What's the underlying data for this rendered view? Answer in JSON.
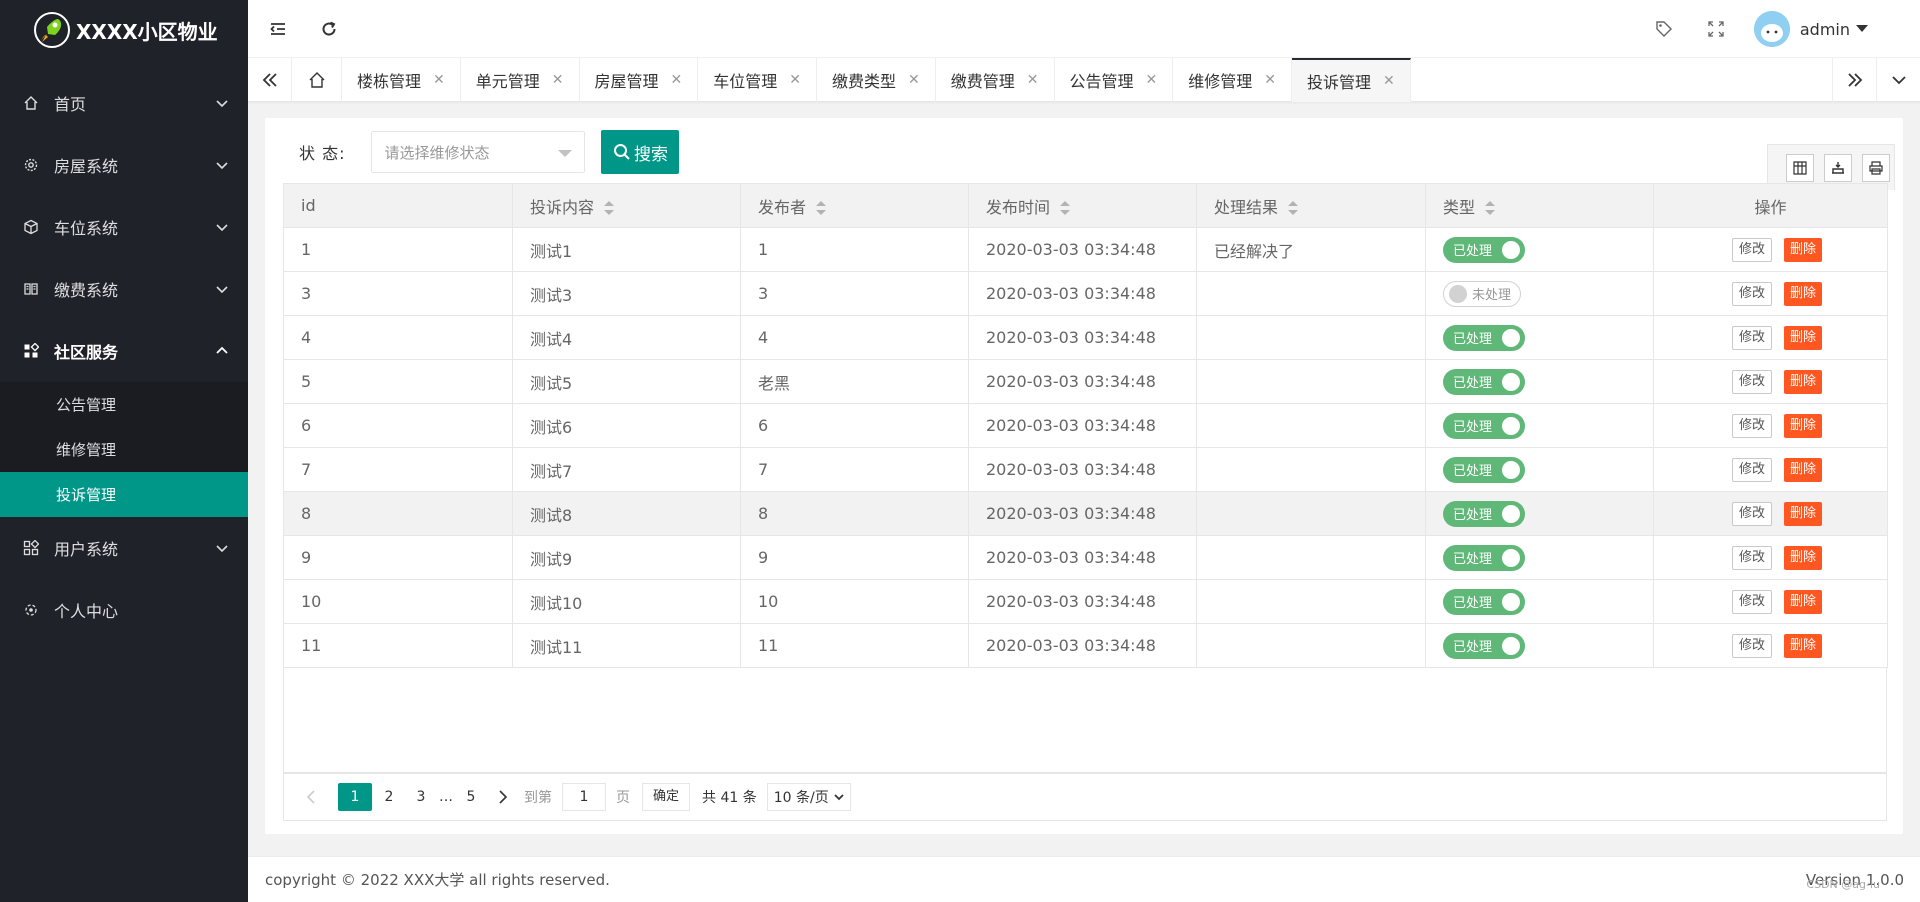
{
  "app": {
    "title": "XXXX小区物业"
  },
  "sidebar": {
    "items": [
      {
        "label": "首页"
      },
      {
        "label": "房屋系统"
      },
      {
        "label": "车位系统"
      },
      {
        "label": "缴费系统"
      },
      {
        "label": "社区服务"
      },
      {
        "label": "用户系统"
      },
      {
        "label": "个人中心"
      }
    ],
    "sub_items": [
      {
        "label": "公告管理"
      },
      {
        "label": "维修管理"
      },
      {
        "label": "投诉管理"
      }
    ]
  },
  "header": {
    "username": "admin"
  },
  "tabs": [
    {
      "label": "楼栋管理"
    },
    {
      "label": "单元管理"
    },
    {
      "label": "房屋管理"
    },
    {
      "label": "车位管理"
    },
    {
      "label": "缴费类型"
    },
    {
      "label": "缴费管理"
    },
    {
      "label": "公告管理"
    },
    {
      "label": "维修管理"
    },
    {
      "label": "投诉管理"
    }
  ],
  "filter": {
    "label": "状 态:",
    "placeholder": "请选择维修状态",
    "search_label": "搜索"
  },
  "table": {
    "columns": [
      "id",
      "投诉内容",
      "发布者",
      "发布时间",
      "处理结果",
      "类型",
      "操作"
    ],
    "edit_label": "修改",
    "delete_label": "删除",
    "rows": [
      {
        "id": "1",
        "content": "测试1",
        "publisher": "1",
        "time": "2020-03-03 03:34:48",
        "result": "已经解决了",
        "status": "已处理",
        "on": true
      },
      {
        "id": "3",
        "content": "测试3",
        "publisher": "3",
        "time": "2020-03-03 03:34:48",
        "result": "",
        "status": "未处理",
        "on": false
      },
      {
        "id": "4",
        "content": "测试4",
        "publisher": "4",
        "time": "2020-03-03 03:34:48",
        "result": "",
        "status": "已处理",
        "on": true
      },
      {
        "id": "5",
        "content": "测试5",
        "publisher": "老黑",
        "time": "2020-03-03 03:34:48",
        "result": "",
        "status": "已处理",
        "on": true
      },
      {
        "id": "6",
        "content": "测试6",
        "publisher": "6",
        "time": "2020-03-03 03:34:48",
        "result": "",
        "status": "已处理",
        "on": true
      },
      {
        "id": "7",
        "content": "测试7",
        "publisher": "7",
        "time": "2020-03-03 03:34:48",
        "result": "",
        "status": "已处理",
        "on": true
      },
      {
        "id": "8",
        "content": "测试8",
        "publisher": "8",
        "time": "2020-03-03 03:34:48",
        "result": "",
        "status": "已处理",
        "on": true
      },
      {
        "id": "9",
        "content": "测试9",
        "publisher": "9",
        "time": "2020-03-03 03:34:48",
        "result": "",
        "status": "已处理",
        "on": true
      },
      {
        "id": "10",
        "content": "测试10",
        "publisher": "10",
        "time": "2020-03-03 03:34:48",
        "result": "",
        "status": "已处理",
        "on": true
      },
      {
        "id": "11",
        "content": "测试11",
        "publisher": "11",
        "time": "2020-03-03 03:34:48",
        "result": "",
        "status": "已处理",
        "on": true
      }
    ]
  },
  "pager": {
    "current": "1",
    "pages": [
      "2",
      "3"
    ],
    "ellipsis": "…",
    "last": "5",
    "goto_label": "到第",
    "goto_value": "1",
    "page_unit": "页",
    "confirm": "确定",
    "total": "共 41 条",
    "limit": "10 条/页"
  },
  "footer": {
    "copyright": "copyright © 2022 XXX大学 all rights reserved.",
    "version": "Version 1.0.0",
    "watermark": "CSDN @ag-lu"
  },
  "colors": {
    "accent": "#009688",
    "sidebar_bg": "#20222a",
    "switch_on": "#5fb878",
    "danger": "#ff5722"
  }
}
